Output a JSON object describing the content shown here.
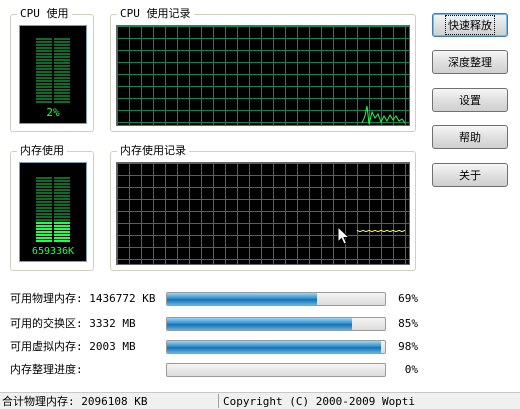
{
  "window": {
    "cpu_group_title": "CPU 使用",
    "cpu_history_title": "CPU 使用记录",
    "mem_group_title": "内存使用",
    "mem_history_title": "内存使用记录"
  },
  "cpu_meter": {
    "label": "2%",
    "level": 0.02,
    "color": "#22ff44"
  },
  "mem_meter": {
    "label": "659336K",
    "level": 0.31,
    "color": "#22ff44"
  },
  "buttons": [
    {
      "label": "快速释放",
      "default": true
    },
    {
      "label": "深度整理",
      "default": false
    },
    {
      "label": "设置",
      "default": false
    },
    {
      "label": "帮助",
      "default": false
    },
    {
      "label": "关于",
      "default": false
    }
  ],
  "stats": [
    {
      "label": "可用物理内存: 1436772 KB",
      "fraction": 0.69,
      "percent": "69%"
    },
    {
      "label": "可用的交换区: 3332 MB",
      "fraction": 0.85,
      "percent": "85%"
    },
    {
      "label": "可用虚拟内存: 2003 MB",
      "fraction": 0.98,
      "percent": "98%"
    },
    {
      "label": "内存整理进度:",
      "fraction": 0.0,
      "percent": "0%"
    }
  ],
  "status_bar": {
    "total": "合计物理内存: 2096108 KB",
    "copyright": "Copyright (C) 2000-2009 Wopti"
  },
  "colors": {
    "grid": "#0b8a57",
    "cpu_trace": "#22ff44",
    "mem_trace": "#ffff66"
  }
}
